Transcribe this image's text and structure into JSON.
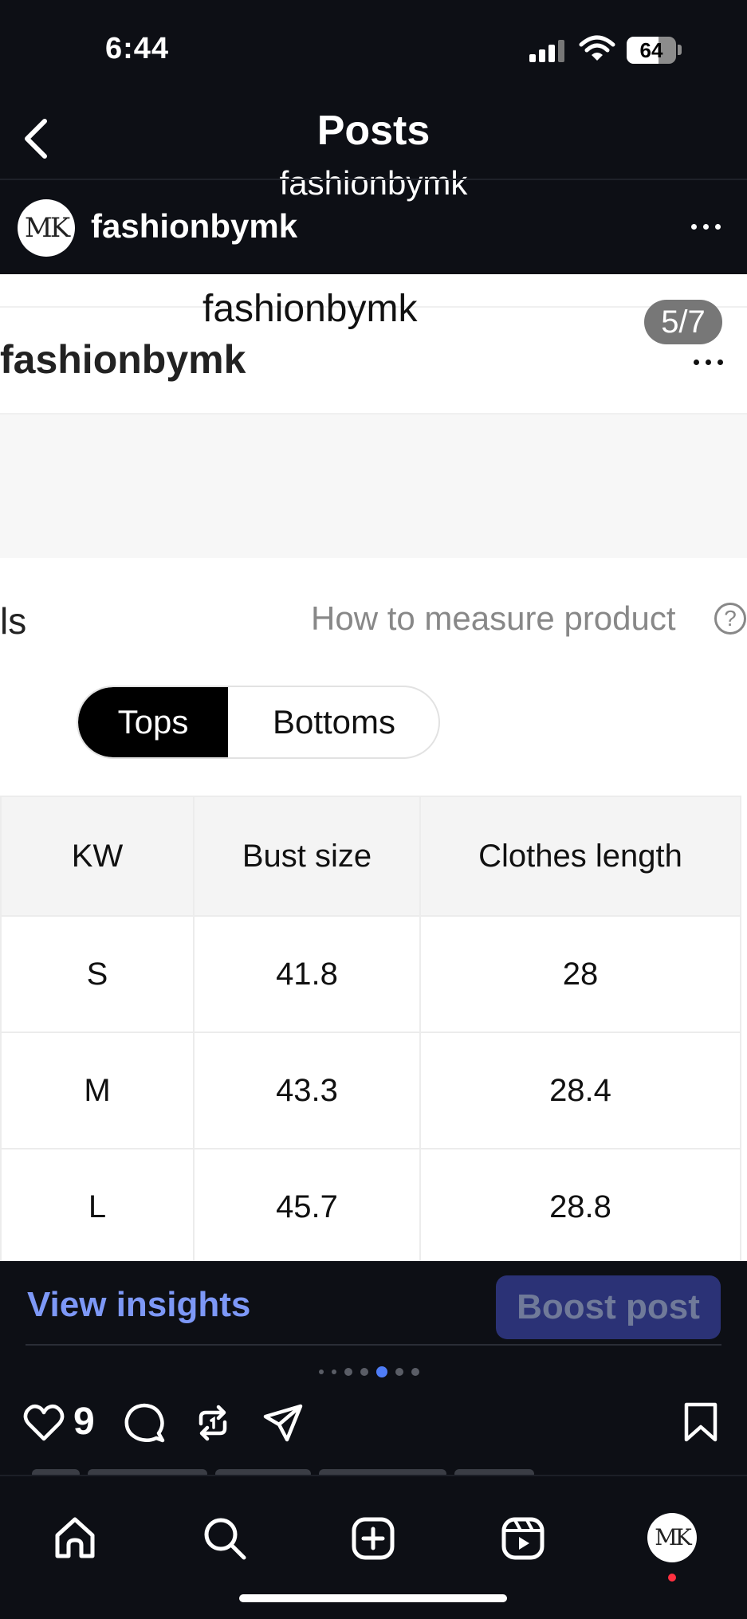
{
  "status_bar": {
    "time": "6:44",
    "battery": "64",
    "battery_level": 0.64
  },
  "header": {
    "title": "Posts",
    "subtitle": "fashionbymk"
  },
  "post": {
    "username": "fashionbymk",
    "avatar_text": "MK",
    "image": {
      "username_center": "fashionbymk",
      "username_left": "fashionbymk",
      "slide_counter": "5/7",
      "section_title_partial": "ls",
      "measure_link": "How to measure product",
      "help_glyph": "?",
      "tabs": [
        {
          "label": "Tops",
          "selected": true
        },
        {
          "label": "Bottoms",
          "selected": false
        }
      ],
      "size_table": {
        "headers": [
          "KW",
          "Bust size",
          "Clothes length"
        ],
        "rows": [
          [
            "S",
            "41.8",
            "28"
          ],
          [
            "M",
            "43.3",
            "28.4"
          ],
          [
            "L",
            "45.7",
            "28.8"
          ]
        ]
      }
    },
    "view_insights": "View insights",
    "boost_post": "Boost post",
    "carousel": {
      "total": 7,
      "active_index": 4
    },
    "like_count": "9"
  },
  "colors": {
    "background": "#0d0f15",
    "insights_link": "#7d98f7",
    "boost_bg": "#2b3276",
    "active_dot": "#4f7df7",
    "notification": "#ff3040"
  },
  "icons": {
    "actions": [
      "heart-icon",
      "comment-icon",
      "repost-icon",
      "share-icon",
      "bookmark-icon"
    ],
    "tabs": [
      "home-icon",
      "search-icon",
      "create-icon",
      "reels-icon",
      "profile-avatar"
    ]
  }
}
